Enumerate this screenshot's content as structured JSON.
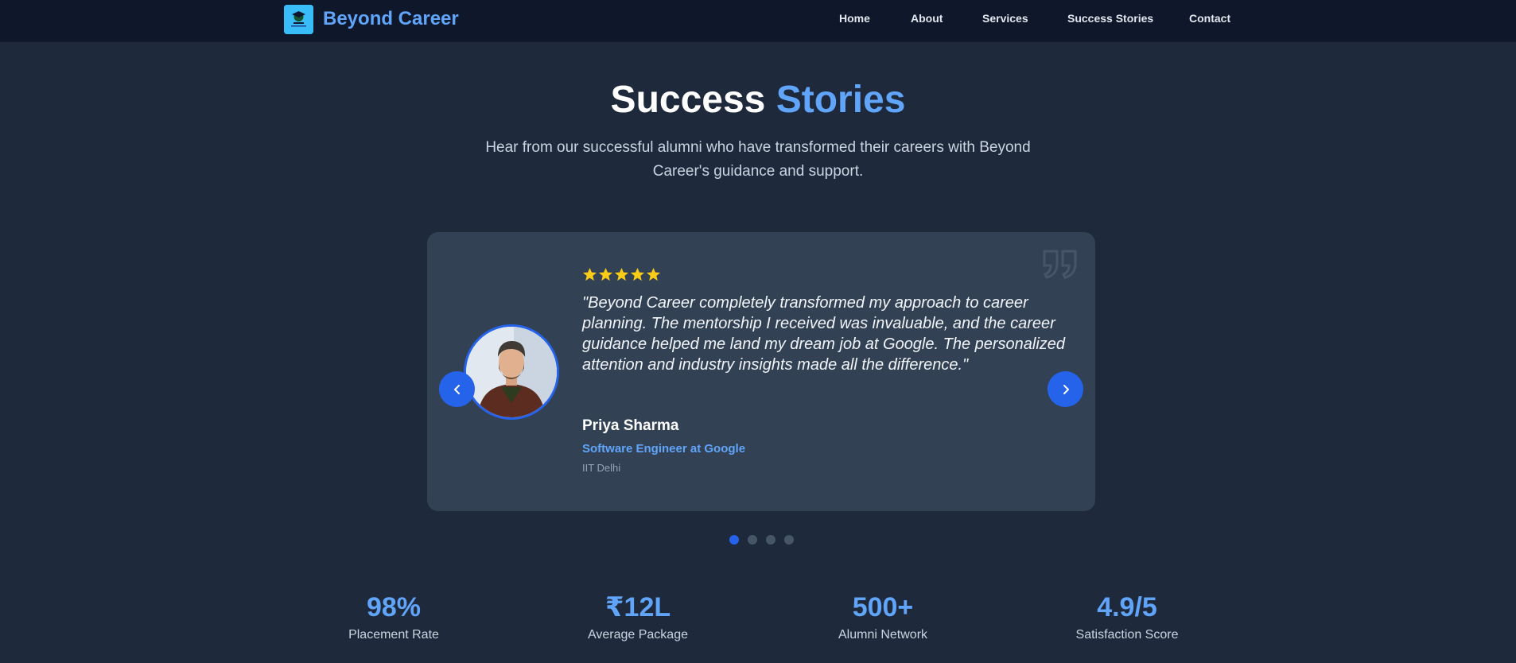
{
  "brand": {
    "name": "Beyond Career",
    "logo_icon": "graduate-logo-icon"
  },
  "nav": {
    "items": [
      {
        "label": "Home"
      },
      {
        "label": "About"
      },
      {
        "label": "Services"
      },
      {
        "label": "Success Stories"
      },
      {
        "label": "Contact"
      }
    ]
  },
  "hero": {
    "title_main": "Success",
    "title_accent": "Stories",
    "subtitle": "Hear from our successful alumni who have transformed their careers with Beyond Career's guidance and support."
  },
  "testimonial": {
    "rating": 5,
    "quote": "\"Beyond Career completely transformed my approach to career planning. The mentorship I received was invaluable, and the career guidance helped me land my dream job at Google. The personalized attention and industry insights made all the difference.\"",
    "name": "Priya Sharma",
    "role": "Software Engineer at Google",
    "school": "IIT Delhi",
    "icons": {
      "prev": "chevron-left-icon",
      "next": "chevron-right-icon",
      "quote": "quote-icon",
      "star": "star-icon"
    }
  },
  "carousel": {
    "total": 4,
    "active_index": 0
  },
  "stats": [
    {
      "value": "98%",
      "label": "Placement Rate"
    },
    {
      "value": "₹12L",
      "label": "Average Package"
    },
    {
      "value": "500+",
      "label": "Alumni Network"
    },
    {
      "value": "4.9/5",
      "label": "Satisfaction Score"
    }
  ],
  "colors": {
    "background": "#1e293b",
    "navbar": "#0f172a",
    "card": "#334155",
    "accent": "#60a5fa",
    "button": "#2563eb",
    "star": "#facc15"
  }
}
